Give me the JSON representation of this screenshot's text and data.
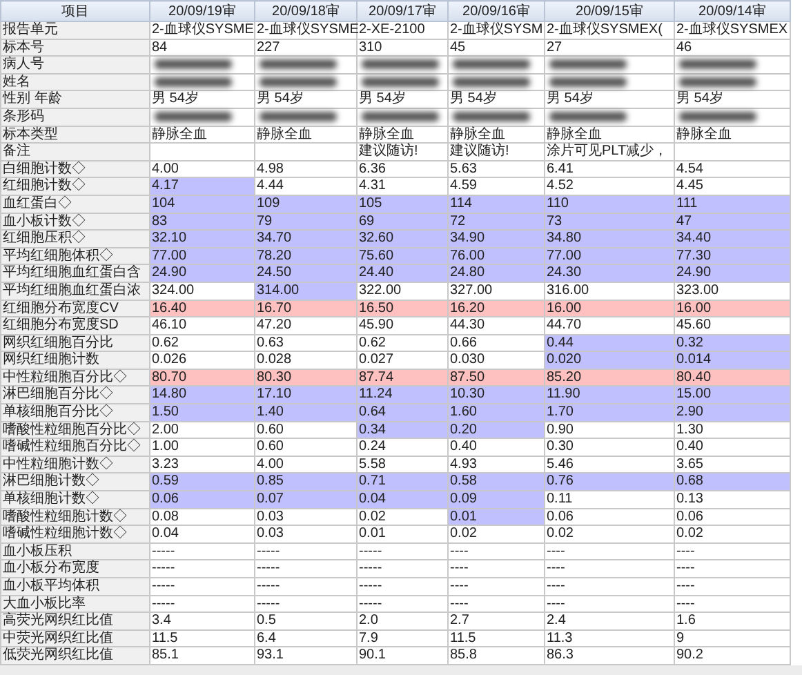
{
  "table": {
    "columns": [
      "项目",
      "20/09/19审",
      "20/09/18审",
      "20/09/17审",
      "20/09/16审",
      "20/09/15审",
      "20/09/14审"
    ],
    "rows": [
      {
        "label": "报告单元",
        "values": [
          {
            "text": "2-血球仪SYSME"
          },
          {
            "text": "2-血球仪SYSME"
          },
          {
            "text": "2-XE-2100"
          },
          {
            "text": "2-血球仪SYSM"
          },
          {
            "text": "2-血球仪SYSMEX("
          },
          {
            "text": "2-血球仪SYSMEX"
          }
        ]
      },
      {
        "label": "标本号",
        "values": [
          {
            "text": "84"
          },
          {
            "text": "227"
          },
          {
            "text": "310"
          },
          {
            "text": "45"
          },
          {
            "text": "27"
          },
          {
            "text": "46"
          }
        ]
      },
      {
        "label": "病人号",
        "redacted": true
      },
      {
        "label": "姓名",
        "redacted": true
      },
      {
        "label": "性别 年龄",
        "values": [
          {
            "text": "男 54岁"
          },
          {
            "text": "男 54岁"
          },
          {
            "text": "男 54岁"
          },
          {
            "text": "男 54岁"
          },
          {
            "text": "男 54岁"
          },
          {
            "text": "男 54岁"
          }
        ]
      },
      {
        "label": "条形码",
        "redacted": true
      },
      {
        "label": "标本类型",
        "values": [
          {
            "text": "静脉全血"
          },
          {
            "text": "静脉全血"
          },
          {
            "text": "静脉全血"
          },
          {
            "text": "静脉全血"
          },
          {
            "text": "静脉全血"
          },
          {
            "text": "静脉全血"
          }
        ]
      },
      {
        "label": "备注",
        "values": [
          {
            "empty": true
          },
          {
            "empty": true
          },
          {
            "text": "建议随访!"
          },
          {
            "text": "建议随访!"
          },
          {
            "text": "涂片可见PLT减少，"
          },
          {
            "empty": true
          }
        ]
      },
      {
        "label": "白细胞计数◇",
        "values": [
          {
            "text": "4.00"
          },
          {
            "text": "4.98"
          },
          {
            "text": "6.36"
          },
          {
            "text": "5.63"
          },
          {
            "text": "6.41"
          },
          {
            "text": "4.54"
          }
        ]
      },
      {
        "label": "红细胞计数◇",
        "values": [
          {
            "text": "4.17",
            "color": "#c0c0ff"
          },
          {
            "text": "4.44"
          },
          {
            "text": "4.31"
          },
          {
            "text": "4.59"
          },
          {
            "text": "4.52"
          },
          {
            "text": "4.45"
          }
        ]
      },
      {
        "label": "血红蛋白◇",
        "values": [
          {
            "text": "104",
            "color": "#c0c0ff"
          },
          {
            "text": "109",
            "color": "#c0c0ff"
          },
          {
            "text": "105",
            "color": "#c0c0ff"
          },
          {
            "text": "114",
            "color": "#c0c0ff"
          },
          {
            "text": "110",
            "color": "#c0c0ff"
          },
          {
            "text": "111",
            "color": "#c0c0ff"
          }
        ]
      },
      {
        "label": "血小板计数◇",
        "values": [
          {
            "text": "83",
            "color": "#c0c0ff"
          },
          {
            "text": "79",
            "color": "#c0c0ff"
          },
          {
            "text": "69",
            "color": "#c0c0ff"
          },
          {
            "text": "72",
            "color": "#c0c0ff"
          },
          {
            "text": "73",
            "color": "#c0c0ff"
          },
          {
            "text": "47",
            "color": "#c0c0ff"
          }
        ]
      },
      {
        "label": "红细胞压积◇",
        "values": [
          {
            "text": "32.10",
            "color": "#c0c0ff"
          },
          {
            "text": "34.70",
            "color": "#c0c0ff"
          },
          {
            "text": "32.60",
            "color": "#c0c0ff"
          },
          {
            "text": "34.90",
            "color": "#c0c0ff"
          },
          {
            "text": "34.80",
            "color": "#c0c0ff"
          },
          {
            "text": "34.40",
            "color": "#c0c0ff"
          }
        ]
      },
      {
        "label": "平均红细胞体积◇",
        "values": [
          {
            "text": "77.00",
            "color": "#c0c0ff"
          },
          {
            "text": "78.20",
            "color": "#c0c0ff"
          },
          {
            "text": "75.60",
            "color": "#c0c0ff"
          },
          {
            "text": "76.00",
            "color": "#c0c0ff"
          },
          {
            "text": "77.00",
            "color": "#c0c0ff"
          },
          {
            "text": "77.30",
            "color": "#c0c0ff"
          }
        ]
      },
      {
        "label": "平均红细胞血红蛋白含",
        "values": [
          {
            "text": "24.90",
            "color": "#c0c0ff"
          },
          {
            "text": "24.50",
            "color": "#c0c0ff"
          },
          {
            "text": "24.40",
            "color": "#c0c0ff"
          },
          {
            "text": "24.80",
            "color": "#c0c0ff"
          },
          {
            "text": "24.30",
            "color": "#c0c0ff"
          },
          {
            "text": "24.90",
            "color": "#c0c0ff"
          }
        ]
      },
      {
        "label": "平均红细胞血红蛋白浓",
        "values": [
          {
            "text": "324.00"
          },
          {
            "text": "314.00",
            "color": "#c0c0ff"
          },
          {
            "text": "322.00"
          },
          {
            "text": "327.00"
          },
          {
            "text": "316.00"
          },
          {
            "text": "323.00"
          }
        ]
      },
      {
        "label": "红细胞分布宽度CV",
        "values": [
          {
            "text": "16.40",
            "color": "#ffc0c0"
          },
          {
            "text": "16.70",
            "color": "#ffc0c0"
          },
          {
            "text": "16.50",
            "color": "#ffc0c0"
          },
          {
            "text": "16.20",
            "color": "#ffc0c0"
          },
          {
            "text": "16.00",
            "color": "#ffc0c0"
          },
          {
            "text": "16.00",
            "color": "#ffc0c0"
          }
        ]
      },
      {
        "label": "红细胞分布宽度SD",
        "values": [
          {
            "text": "46.10"
          },
          {
            "text": "47.20"
          },
          {
            "text": "45.90"
          },
          {
            "text": "44.30"
          },
          {
            "text": "44.70"
          },
          {
            "text": "45.60"
          }
        ]
      },
      {
        "label": "网织红细胞百分比",
        "values": [
          {
            "text": "0.62"
          },
          {
            "text": "0.63"
          },
          {
            "text": "0.62"
          },
          {
            "text": "0.66"
          },
          {
            "text": "0.44",
            "color": "#c0c0ff"
          },
          {
            "text": "0.32",
            "color": "#c0c0ff"
          }
        ]
      },
      {
        "label": "网织红细胞计数",
        "values": [
          {
            "text": "0.026"
          },
          {
            "text": "0.028"
          },
          {
            "text": "0.027"
          },
          {
            "text": "0.030"
          },
          {
            "text": "0.020",
            "color": "#c0c0ff"
          },
          {
            "text": "0.014",
            "color": "#c0c0ff"
          }
        ]
      },
      {
        "label": "中性粒细胞百分比◇",
        "values": [
          {
            "text": "80.70",
            "color": "#ffc0c0"
          },
          {
            "text": "80.30",
            "color": "#ffc0c0"
          },
          {
            "text": "87.74",
            "color": "#ffc0c0"
          },
          {
            "text": "87.50",
            "color": "#ffc0c0"
          },
          {
            "text": "85.20",
            "color": "#ffc0c0"
          },
          {
            "text": "80.40",
            "color": "#ffc0c0"
          }
        ]
      },
      {
        "label": "淋巴细胞百分比◇",
        "values": [
          {
            "text": "14.80",
            "color": "#c0c0ff"
          },
          {
            "text": "17.10",
            "color": "#c0c0ff"
          },
          {
            "text": "11.24",
            "color": "#c0c0ff"
          },
          {
            "text": "10.30",
            "color": "#c0c0ff"
          },
          {
            "text": "11.90",
            "color": "#c0c0ff"
          },
          {
            "text": "15.00",
            "color": "#c0c0ff"
          }
        ]
      },
      {
        "label": "单核细胞百分比◇",
        "values": [
          {
            "text": "1.50",
            "color": "#c0c0ff"
          },
          {
            "text": "1.40",
            "color": "#c0c0ff"
          },
          {
            "text": "0.64",
            "color": "#c0c0ff"
          },
          {
            "text": "1.60",
            "color": "#c0c0ff"
          },
          {
            "text": "1.70",
            "color": "#c0c0ff"
          },
          {
            "text": "2.90",
            "color": "#c0c0ff"
          }
        ]
      },
      {
        "label": "嗜酸性粒细胞百分比◇",
        "values": [
          {
            "text": "2.00"
          },
          {
            "text": "0.60"
          },
          {
            "text": "0.34",
            "color": "#c0c0ff"
          },
          {
            "text": "0.20",
            "color": "#c0c0ff"
          },
          {
            "text": "0.90"
          },
          {
            "text": "1.30"
          }
        ]
      },
      {
        "label": "嗜碱性粒细胞百分比◇",
        "values": [
          {
            "text": "1.00"
          },
          {
            "text": "0.60"
          },
          {
            "text": "0.24"
          },
          {
            "text": "0.40"
          },
          {
            "text": "0.30"
          },
          {
            "text": "0.40"
          }
        ]
      },
      {
        "label": "中性粒细胞计数◇",
        "values": [
          {
            "text": "3.23"
          },
          {
            "text": "4.00"
          },
          {
            "text": "5.58"
          },
          {
            "text": "4.93"
          },
          {
            "text": "5.46"
          },
          {
            "text": "3.65"
          }
        ]
      },
      {
        "label": "淋巴细胞计数◇",
        "values": [
          {
            "text": "0.59",
            "color": "#c0c0ff"
          },
          {
            "text": "0.85",
            "color": "#c0c0ff"
          },
          {
            "text": "0.71",
            "color": "#c0c0ff"
          },
          {
            "text": "0.58",
            "color": "#c0c0ff"
          },
          {
            "text": "0.76",
            "color": "#c0c0ff"
          },
          {
            "text": "0.68",
            "color": "#c0c0ff"
          }
        ]
      },
      {
        "label": "单核细胞计数◇",
        "values": [
          {
            "text": "0.06",
            "color": "#c0c0ff"
          },
          {
            "text": "0.07",
            "color": "#c0c0ff"
          },
          {
            "text": "0.04",
            "color": "#c0c0ff"
          },
          {
            "text": "0.09",
            "color": "#c0c0ff"
          },
          {
            "text": "0.11"
          },
          {
            "text": "0.13"
          }
        ]
      },
      {
        "label": "嗜酸性粒细胞计数◇",
        "values": [
          {
            "text": "0.08"
          },
          {
            "text": "0.03"
          },
          {
            "text": "0.02"
          },
          {
            "text": "0.01",
            "color": "#c0c0ff"
          },
          {
            "text": "0.06"
          },
          {
            "text": "0.06"
          }
        ]
      },
      {
        "label": "嗜碱性粒细胞计数◇",
        "values": [
          {
            "text": "0.04"
          },
          {
            "text": "0.03"
          },
          {
            "text": "0.01"
          },
          {
            "text": "0.02"
          },
          {
            "text": "0.02"
          },
          {
            "text": "0.02"
          }
        ]
      },
      {
        "label": "血小板压积",
        "values": [
          {
            "text": "-----"
          },
          {
            "text": "-----"
          },
          {
            "text": "-----"
          },
          {
            "text": "----"
          },
          {
            "text": "----"
          },
          {
            "text": "----"
          }
        ]
      },
      {
        "label": "血小板分布宽度",
        "values": [
          {
            "text": "-----"
          },
          {
            "text": "-----"
          },
          {
            "text": "-----"
          },
          {
            "text": "----"
          },
          {
            "text": "----"
          },
          {
            "text": "----"
          }
        ]
      },
      {
        "label": "血小板平均体积",
        "values": [
          {
            "text": "-----"
          },
          {
            "text": "-----"
          },
          {
            "text": "-----"
          },
          {
            "text": "----"
          },
          {
            "text": "----"
          },
          {
            "text": "----"
          }
        ]
      },
      {
        "label": "大血小板比率",
        "values": [
          {
            "text": "-----"
          },
          {
            "text": "-----"
          },
          {
            "text": "-----"
          },
          {
            "text": "----"
          },
          {
            "text": "----"
          },
          {
            "text": "----"
          }
        ]
      },
      {
        "label": "高荧光网织红比值",
        "values": [
          {
            "text": "3.4"
          },
          {
            "text": "0.5"
          },
          {
            "text": "2.0"
          },
          {
            "text": "2.7"
          },
          {
            "text": "2.4"
          },
          {
            "text": "1.6"
          }
        ]
      },
      {
        "label": "中荧光网织红比值",
        "values": [
          {
            "text": "11.5"
          },
          {
            "text": "6.4"
          },
          {
            "text": "7.9"
          },
          {
            "text": "11.5"
          },
          {
            "text": "11.3"
          },
          {
            "text": "9"
          }
        ]
      },
      {
        "label": "低荧光网织红比值",
        "values": [
          {
            "text": "85.1"
          },
          {
            "text": "93.1"
          },
          {
            "text": "90.1"
          },
          {
            "text": "85.8"
          },
          {
            "text": "86.3"
          },
          {
            "text": "90.2"
          }
        ]
      }
    ]
  }
}
